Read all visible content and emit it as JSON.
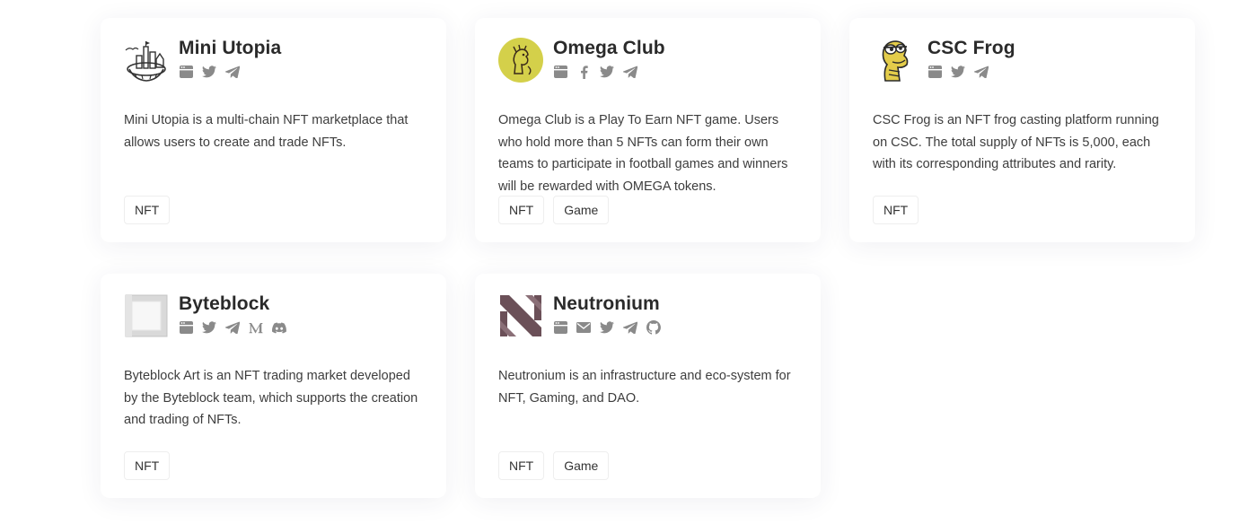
{
  "projects": [
    {
      "name": "Mini Utopia",
      "description": "Mini Utopia is a multi-chain NFT marketplace that allows users to create and trade NFTs.",
      "tags": [
        "NFT"
      ],
      "socials": [
        "website-icon",
        "twitter-icon",
        "telegram-icon"
      ]
    },
    {
      "name": "Omega Club",
      "description": "Omega Club is a Play To Earn NFT game. Users who hold more than 5 NFTs can form their own teams to participate in football games and winners will be rewarded with OMEGA tokens.",
      "tags": [
        "NFT",
        "Game"
      ],
      "socials": [
        "website-icon",
        "facebook-icon",
        "twitter-icon",
        "telegram-icon"
      ]
    },
    {
      "name": "CSC Frog",
      "description": "CSC Frog is an NFT frog casting platform running on CSC. The total supply of NFTs is 5,000, each with its corresponding attributes and rarity.",
      "tags": [
        "NFT"
      ],
      "socials": [
        "website-icon",
        "twitter-icon",
        "telegram-icon"
      ]
    },
    {
      "name": "Byteblock",
      "description": "Byteblock Art is an NFT trading market developed by the Byteblock team, which supports the creation and trading of NFTs.",
      "tags": [
        "NFT"
      ],
      "socials": [
        "website-icon",
        "twitter-icon",
        "telegram-icon",
        "medium-icon",
        "discord-icon"
      ]
    },
    {
      "name": "Neutronium",
      "description": "Neutronium is an infrastructure and eco-system for NFT, Gaming, and DAO.",
      "tags": [
        "NFT",
        "Game"
      ],
      "socials": [
        "website-icon",
        "email-icon",
        "twitter-icon",
        "telegram-icon",
        "github-icon"
      ]
    }
  ],
  "colors": {
    "icon": "#8a8a8a",
    "text": "#333333",
    "tag_border": "#eeeeee"
  }
}
